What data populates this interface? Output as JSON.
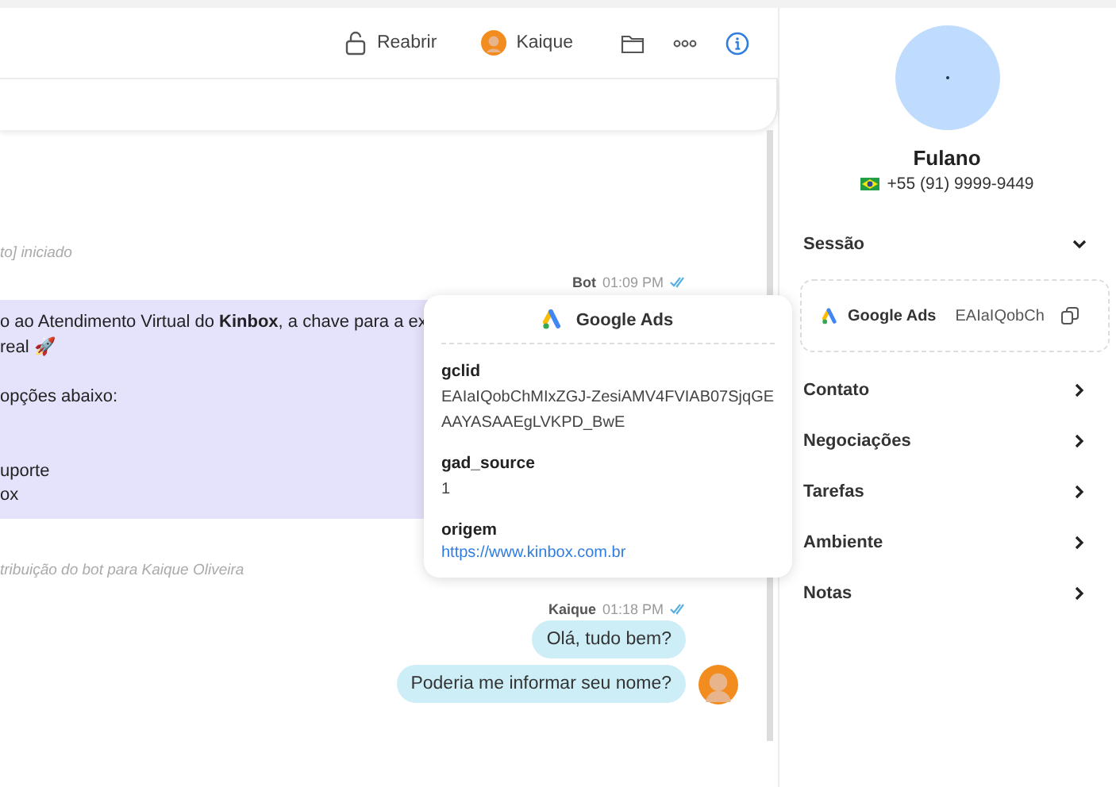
{
  "header": {
    "reopen_label": "Reabrir",
    "agent_name": "Kaique",
    "info_active": true
  },
  "chat": {
    "system_start": "to] iniciado",
    "bot": {
      "sender": "Bot",
      "time": "01:09 PM",
      "paragraphs": [
        [
          "o ao Atendimento Virtual do **Kinbox**, a chave para a ex",
          "real 🚀"
        ],
        [
          "opções abaixo:"
        ],
        [
          "uporte",
          "ox"
        ]
      ]
    },
    "system_transfer": "tribuição do bot para Kaique Oliveira",
    "agent": {
      "sender": "Kaique",
      "time": "01:18 PM",
      "messages": [
        "Olá, tudo bem?",
        "Poderia me informar seu nome?"
      ]
    }
  },
  "popover": {
    "title": "Google Ads",
    "fields": [
      {
        "label": "gclid",
        "value": "EAIaIQobChMIxZGJ-ZesiAMV4FVIAB07SjqGEAAYASAAEgLVKPD_BwE",
        "kind": "text"
      },
      {
        "label": "gad_source",
        "value": "1",
        "kind": "text"
      },
      {
        "label": "origem",
        "value": "https://www.kinbox.com.br",
        "kind": "link"
      }
    ]
  },
  "contact": {
    "name": "Fulano",
    "phone": "+55 (91) 9999-9449"
  },
  "sections": [
    {
      "label": "Sessão",
      "expanded": true
    },
    {
      "label": "Contato",
      "expanded": false
    },
    {
      "label": "Negociações",
      "expanded": false
    },
    {
      "label": "Tarefas",
      "expanded": false
    },
    {
      "label": "Ambiente",
      "expanded": false
    },
    {
      "label": "Notas",
      "expanded": false
    }
  ],
  "session_card": {
    "source": "Google Ads",
    "value": "EAIaIQobCh"
  }
}
